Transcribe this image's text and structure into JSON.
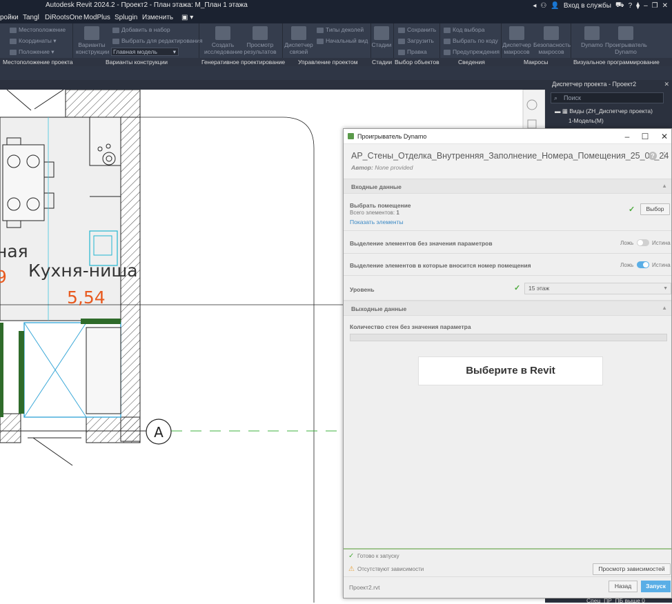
{
  "revit": {
    "title": "Autodesk Revit 2024.2 - Проект2 - План этажа: М_План 1 этажа",
    "signin": "Вход в службы",
    "menu": [
      "ройки",
      "Tangl",
      "DiRootsOne",
      "ModPlus",
      "Splugin",
      "Изменить"
    ],
    "ribbon": {
      "tools": {
        "location": "Местоположение",
        "coordinates": "Координаты",
        "position": "Положение",
        "design_options": "Варианты конструкции",
        "add_to_set": "Добавить в набор",
        "pick_to_edit": "Выбрать для редактирования",
        "main_model": "Главная модель",
        "create_study": "Создать исследование",
        "view_results": "Просмотр результатов",
        "link_manager": "Диспетчер связей",
        "decal_types": "Типы деколей",
        "starting_view": "Начальный вид",
        "phases": "Стадии",
        "save": "Сохранить",
        "load": "Загрузить",
        "edit": "Правка",
        "selection_id": "Код выбора",
        "select_by_id": "Выбрать по коду",
        "warnings": "Предупреждения",
        "macro_manager": "Диспетчер макросов",
        "macro_security": "Безопасность макросов",
        "dynamo": "Dynamo",
        "dynamo_player": "Проигрыватель Dynamo"
      },
      "panels": {
        "p1": "Местоположение проекта",
        "p2": "Варианты конструкции",
        "p3": "Генеративное проектирование",
        "p4": "Управление проектом",
        "p5": "Стадии",
        "p6": "Выбор объектов",
        "p7": "Сведения",
        "p8": "Макросы",
        "p9": "Визуальное программирование"
      }
    },
    "browser": {
      "title": "Диспетчер проекта - Проект2",
      "search_placeholder": "Поиск",
      "views": "Виды (ZH_Диспетчер проекта)",
      "model": "1-Модель(М)",
      "bottom_item": "Спец_ПР_ПБ выше 0"
    },
    "plan": {
      "room1_name": "Кухня-ниша",
      "room1_area": "5,54",
      "room2_partial": "ная",
      "room2_area_partial": "9",
      "grid_label": "A"
    }
  },
  "dynamo": {
    "window_title": "Проигрыватель Dynamo",
    "script_name": "АР_Стены_Отделка_Внутренняя_Заполнение_Номера_Помещения_25_01_24",
    "author_label": "Автор:",
    "author_value": "None provided",
    "inputs_header": "Входные данные",
    "select_room": {
      "label": "Выбрать помещение",
      "count_label": "Всего элементов:",
      "count_value": "1",
      "show_link": "Показать элементы",
      "button": "Выбор"
    },
    "toggle1": {
      "label": "Выделение элементов без значения параметров",
      "off": "Ложь",
      "on": "Истина",
      "value": false
    },
    "toggle2": {
      "label": "Выделение элементов в которые вносится номер помещения",
      "off": "Ложь",
      "on": "Истина",
      "value": true
    },
    "level": {
      "label": "Уровень",
      "value": "15 этаж"
    },
    "outputs_header": "Выходные данные",
    "output1": {
      "label": "Количество стен без значения параметра"
    },
    "select_in_revit": "Выберите в Revit",
    "status_ready": "Готово к запуску",
    "status_missing": "Отсутствуют зависимости",
    "view_deps": "Просмотр зависимостей",
    "file": "Проект2.rvt",
    "back": "Назад",
    "run": "Запуск"
  },
  "colors": {
    "accent": "#5aaee6",
    "ok": "#4caa3c",
    "warn": "#e6a23c",
    "room_area": "#e85a1f",
    "wall_green": "#2f6b2a"
  }
}
